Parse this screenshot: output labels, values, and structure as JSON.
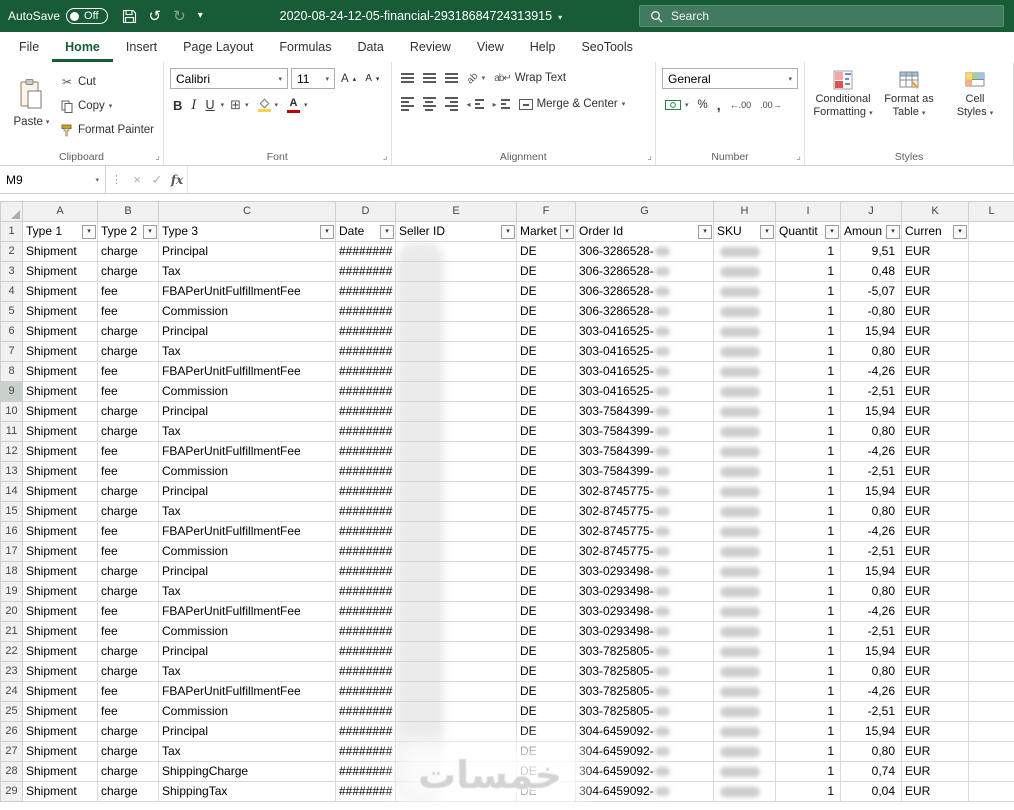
{
  "titlebar": {
    "autosave_label": "AutoSave",
    "autosave_state": "Off",
    "filename": "2020-08-24-12-05-financial-29318684724313915",
    "search_placeholder": "Search"
  },
  "tabs": [
    {
      "label": "File",
      "active": false
    },
    {
      "label": "Home",
      "active": true
    },
    {
      "label": "Insert",
      "active": false
    },
    {
      "label": "Page Layout",
      "active": false
    },
    {
      "label": "Formulas",
      "active": false
    },
    {
      "label": "Data",
      "active": false
    },
    {
      "label": "Review",
      "active": false
    },
    {
      "label": "View",
      "active": false
    },
    {
      "label": "Help",
      "active": false
    },
    {
      "label": "SeoTools",
      "active": false
    }
  ],
  "ribbon": {
    "clipboard": {
      "group_label": "Clipboard",
      "paste_label": "Paste",
      "cut_label": "Cut",
      "copy_label": "Copy",
      "format_painter_label": "Format Painter"
    },
    "font": {
      "group_label": "Font",
      "font_name": "Calibri",
      "font_size": "11"
    },
    "alignment": {
      "group_label": "Alignment",
      "wrap_text_label": "Wrap Text",
      "merge_center_label": "Merge & Center"
    },
    "number": {
      "group_label": "Number",
      "number_format": "General"
    },
    "styles": {
      "group_label": "Styles",
      "conditional_line1": "Conditional",
      "conditional_line2": "Formatting",
      "format_table_line1": "Format as",
      "format_table_line2": "Table",
      "cell_styles_line1": "Cell",
      "cell_styles_line2": "Styles"
    }
  },
  "formula_bar": {
    "name_box": "M9",
    "formula_value": ""
  },
  "sheet": {
    "column_letters": [
      "A",
      "B",
      "C",
      "D",
      "E",
      "F",
      "G",
      "H",
      "I",
      "J",
      "K",
      "L"
    ],
    "filter_headers": [
      "Type 1",
      "Type 2",
      "Type 3",
      "Date",
      "Seller ID",
      "Market",
      "Order Id",
      "SKU",
      "Quantit",
      "Amoun",
      "Curren",
      ""
    ],
    "highlighted_row": 9,
    "rows": [
      {
        "n": 2,
        "type1": "Shipment",
        "type2": "charge",
        "type3": "Principal",
        "date": "########",
        "market": "DE",
        "order_id": "306-3286528-",
        "quantity": "1",
        "amount": "9,51",
        "currency": "EUR"
      },
      {
        "n": 3,
        "type1": "Shipment",
        "type2": "charge",
        "type3": "Tax",
        "date": "########",
        "market": "DE",
        "order_id": "306-3286528-",
        "quantity": "1",
        "amount": "0,48",
        "currency": "EUR"
      },
      {
        "n": 4,
        "type1": "Shipment",
        "type2": "fee",
        "type3": "FBAPerUnitFulfillmentFee",
        "date": "########",
        "market": "DE",
        "order_id": "306-3286528-",
        "quantity": "1",
        "amount": "-5,07",
        "currency": "EUR"
      },
      {
        "n": 5,
        "type1": "Shipment",
        "type2": "fee",
        "type3": "Commission",
        "date": "########",
        "market": "DE",
        "order_id": "306-3286528-",
        "quantity": "1",
        "amount": "-0,80",
        "currency": "EUR"
      },
      {
        "n": 6,
        "type1": "Shipment",
        "type2": "charge",
        "type3": "Principal",
        "date": "########",
        "market": "DE",
        "order_id": "303-0416525-",
        "quantity": "1",
        "amount": "15,94",
        "currency": "EUR"
      },
      {
        "n": 7,
        "type1": "Shipment",
        "type2": "charge",
        "type3": "Tax",
        "date": "########",
        "market": "DE",
        "order_id": "303-0416525-",
        "quantity": "1",
        "amount": "0,80",
        "currency": "EUR"
      },
      {
        "n": 8,
        "type1": "Shipment",
        "type2": "fee",
        "type3": "FBAPerUnitFulfillmentFee",
        "date": "########",
        "market": "DE",
        "order_id": "303-0416525-",
        "quantity": "1",
        "amount": "-4,26",
        "currency": "EUR"
      },
      {
        "n": 9,
        "type1": "Shipment",
        "type2": "fee",
        "type3": "Commission",
        "date": "########",
        "market": "DE",
        "order_id": "303-0416525-",
        "quantity": "1",
        "amount": "-2,51",
        "currency": "EUR"
      },
      {
        "n": 10,
        "type1": "Shipment",
        "type2": "charge",
        "type3": "Principal",
        "date": "########",
        "market": "DE",
        "order_id": "303-7584399-",
        "quantity": "1",
        "amount": "15,94",
        "currency": "EUR"
      },
      {
        "n": 11,
        "type1": "Shipment",
        "type2": "charge",
        "type3": "Tax",
        "date": "########",
        "market": "DE",
        "order_id": "303-7584399-",
        "quantity": "1",
        "amount": "0,80",
        "currency": "EUR"
      },
      {
        "n": 12,
        "type1": "Shipment",
        "type2": "fee",
        "type3": "FBAPerUnitFulfillmentFee",
        "date": "########",
        "market": "DE",
        "order_id": "303-7584399-",
        "quantity": "1",
        "amount": "-4,26",
        "currency": "EUR"
      },
      {
        "n": 13,
        "type1": "Shipment",
        "type2": "fee",
        "type3": "Commission",
        "date": "########",
        "market": "DE",
        "order_id": "303-7584399-",
        "quantity": "1",
        "amount": "-2,51",
        "currency": "EUR"
      },
      {
        "n": 14,
        "type1": "Shipment",
        "type2": "charge",
        "type3": "Principal",
        "date": "########",
        "market": "DE",
        "order_id": "302-8745775-",
        "quantity": "1",
        "amount": "15,94",
        "currency": "EUR"
      },
      {
        "n": 15,
        "type1": "Shipment",
        "type2": "charge",
        "type3": "Tax",
        "date": "########",
        "market": "DE",
        "order_id": "302-8745775-",
        "quantity": "1",
        "amount": "0,80",
        "currency": "EUR"
      },
      {
        "n": 16,
        "type1": "Shipment",
        "type2": "fee",
        "type3": "FBAPerUnitFulfillmentFee",
        "date": "########",
        "market": "DE",
        "order_id": "302-8745775-",
        "quantity": "1",
        "amount": "-4,26",
        "currency": "EUR"
      },
      {
        "n": 17,
        "type1": "Shipment",
        "type2": "fee",
        "type3": "Commission",
        "date": "########",
        "market": "DE",
        "order_id": "302-8745775-",
        "quantity": "1",
        "amount": "-2,51",
        "currency": "EUR"
      },
      {
        "n": 18,
        "type1": "Shipment",
        "type2": "charge",
        "type3": "Principal",
        "date": "########",
        "market": "DE",
        "order_id": "303-0293498-",
        "quantity": "1",
        "amount": "15,94",
        "currency": "EUR"
      },
      {
        "n": 19,
        "type1": "Shipment",
        "type2": "charge",
        "type3": "Tax",
        "date": "########",
        "market": "DE",
        "order_id": "303-0293498-",
        "quantity": "1",
        "amount": "0,80",
        "currency": "EUR"
      },
      {
        "n": 20,
        "type1": "Shipment",
        "type2": "fee",
        "type3": "FBAPerUnitFulfillmentFee",
        "date": "########",
        "market": "DE",
        "order_id": "303-0293498-",
        "quantity": "1",
        "amount": "-4,26",
        "currency": "EUR"
      },
      {
        "n": 21,
        "type1": "Shipment",
        "type2": "fee",
        "type3": "Commission",
        "date": "########",
        "market": "DE",
        "order_id": "303-0293498-",
        "quantity": "1",
        "amount": "-2,51",
        "currency": "EUR"
      },
      {
        "n": 22,
        "type1": "Shipment",
        "type2": "charge",
        "type3": "Principal",
        "date": "########",
        "market": "DE",
        "order_id": "303-7825805-",
        "quantity": "1",
        "amount": "15,94",
        "currency": "EUR"
      },
      {
        "n": 23,
        "type1": "Shipment",
        "type2": "charge",
        "type3": "Tax",
        "date": "########",
        "market": "DE",
        "order_id": "303-7825805-",
        "quantity": "1",
        "amount": "0,80",
        "currency": "EUR"
      },
      {
        "n": 24,
        "type1": "Shipment",
        "type2": "fee",
        "type3": "FBAPerUnitFulfillmentFee",
        "date": "########",
        "market": "DE",
        "order_id": "303-7825805-",
        "quantity": "1",
        "amount": "-4,26",
        "currency": "EUR"
      },
      {
        "n": 25,
        "type1": "Shipment",
        "type2": "fee",
        "type3": "Commission",
        "date": "########",
        "market": "DE",
        "order_id": "303-7825805-",
        "quantity": "1",
        "amount": "-2,51",
        "currency": "EUR"
      },
      {
        "n": 26,
        "type1": "Shipment",
        "type2": "charge",
        "type3": "Principal",
        "date": "########",
        "market": "DE",
        "order_id": "304-6459092-",
        "quantity": "1",
        "amount": "15,94",
        "currency": "EUR"
      },
      {
        "n": 27,
        "type1": "Shipment",
        "type2": "charge",
        "type3": "Tax",
        "date": "########",
        "market": "DE",
        "order_id": "304-6459092-",
        "quantity": "1",
        "amount": "0,80",
        "currency": "EUR"
      },
      {
        "n": 28,
        "type1": "Shipment",
        "type2": "charge",
        "type3": "ShippingCharge",
        "date": "########",
        "market": "DE",
        "order_id": "304-6459092-",
        "quantity": "1",
        "amount": "0,74",
        "currency": "EUR"
      },
      {
        "n": 29,
        "type1": "Shipment",
        "type2": "charge",
        "type3": "ShippingTax",
        "date": "########",
        "market": "DE",
        "order_id": "304-6459092-",
        "quantity": "1",
        "amount": "0,04",
        "currency": "EUR"
      }
    ]
  },
  "watermark_text": "خمسات",
  "colors": {
    "accent_green": "#185c37",
    "font_color_red": "#c00000",
    "fill_color_yellow": "#ffd34d"
  }
}
